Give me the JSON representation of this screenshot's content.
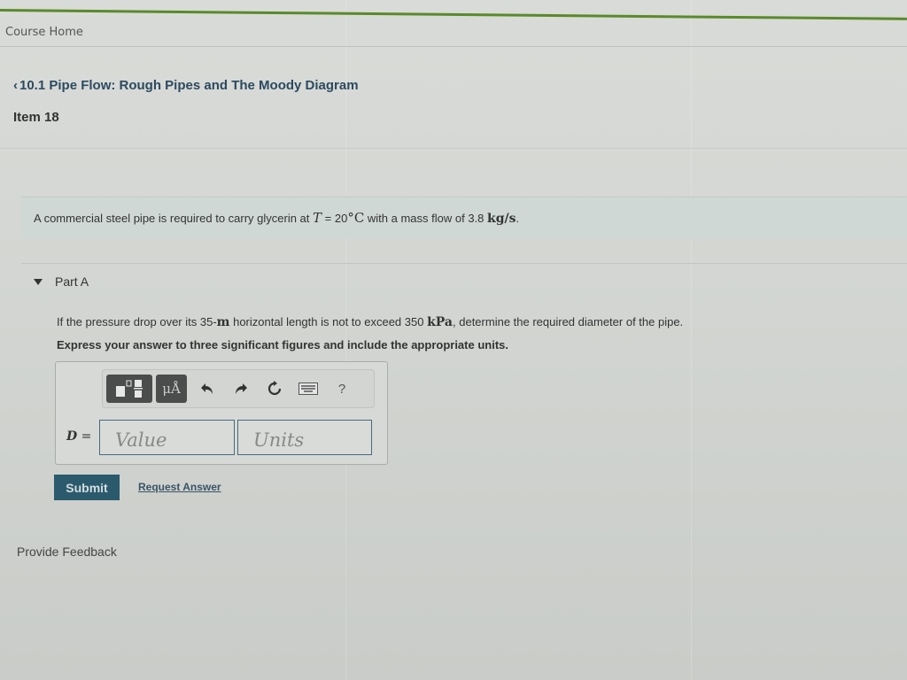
{
  "header": {
    "course_home": "Course Home"
  },
  "breadcrumb": {
    "chevron": "‹",
    "label": "10.1 Pipe Flow: Rough Pipes and The Moody Diagram"
  },
  "item": {
    "title": "Item 18"
  },
  "problem": {
    "text_1": "A commercial steel pipe is required to carry glycerin at ",
    "var_T": "T",
    "text_2": " = 20",
    "deg_unit": "°C",
    "text_3": " with a mass flow of 3.8 ",
    "flow_unit": "kg/s",
    "text_4": "."
  },
  "part_a": {
    "label": "Part A",
    "expanded": true,
    "question_1": "If the pressure drop over its 35-",
    "length_unit": "m",
    "question_2": " horizontal length is not to exceed 350 ",
    "pressure_unit": "kPa",
    "question_3": ", determine the required diameter of the pipe.",
    "instruction": "Express your answer to three significant figures and include the appropriate units.",
    "toolbar": {
      "templates_icon": "templates-icon",
      "symbols_label": "μÅ",
      "undo_icon": "undo-icon",
      "redo_icon": "redo-icon",
      "reset_icon": "reset-icon",
      "keyboard_icon": "keyboard-icon",
      "help_label": "?"
    },
    "answer_var": "D",
    "answer_eq": " =",
    "value_placeholder": "Value",
    "units_placeholder": "Units",
    "value": "",
    "units": "",
    "submit_label": "Submit",
    "request_answer_label": "Request Answer"
  },
  "footer": {
    "feedback_label": "Provide Feedback"
  },
  "colors": {
    "accent_green": "#5a8a2a",
    "submit_bg": "#2b5a6c",
    "link": "#2c4a60"
  }
}
